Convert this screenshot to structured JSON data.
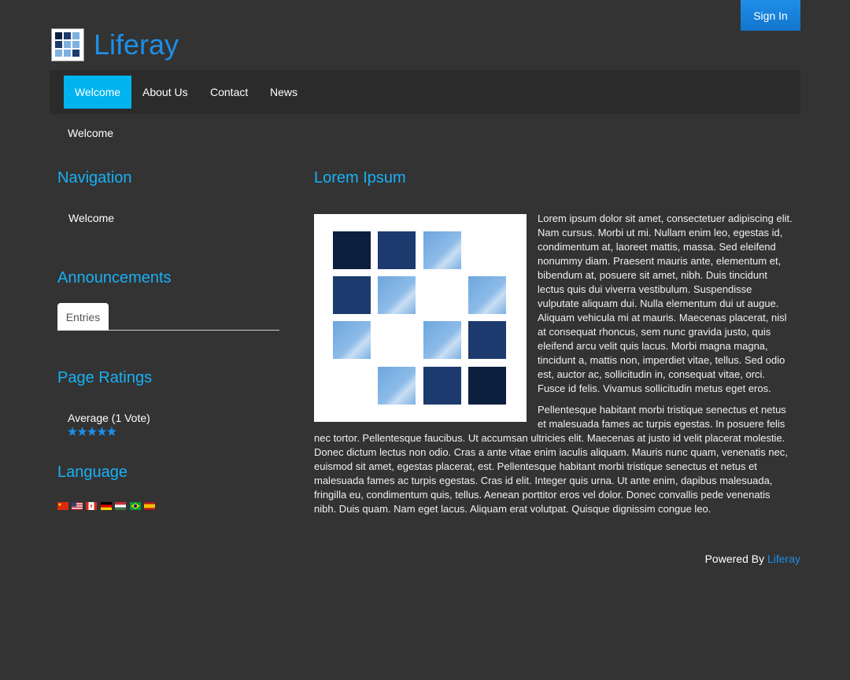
{
  "header": {
    "sign_in_label": "Sign In",
    "site_title": "Liferay",
    "brand_color": "#1e8fe6"
  },
  "nav": {
    "items": [
      {
        "label": "Welcome",
        "active": true
      },
      {
        "label": "About Us",
        "active": false
      },
      {
        "label": "Contact",
        "active": false
      },
      {
        "label": "News",
        "active": false
      }
    ],
    "active_color": "#00b4ef"
  },
  "breadcrumb": "Welcome",
  "navigation_portlet": {
    "title": "Navigation",
    "items": [
      "Welcome"
    ]
  },
  "announcements_portlet": {
    "title": "Announcements",
    "tab_label": "Entries"
  },
  "page_ratings_portlet": {
    "title": "Page Ratings",
    "summary": "Average (1 Vote)",
    "stars_filled": 5,
    "stars_total": 5
  },
  "language_portlet": {
    "title": "Language",
    "flags": [
      "chinese-flag-icon",
      "us-flag-icon",
      "canada-flag-icon",
      "german-flag-icon",
      "hungarian-flag-icon",
      "brazilian-flag-icon",
      "spanish-flag-icon"
    ]
  },
  "content": {
    "title": "Lorem Ipsum",
    "paragraph_1": "Lorem ipsum dolor sit amet, consectetuer adipiscing elit. Nam cursus. Morbi ut mi. Nullam enim leo, egestas id, condimentum at, laoreet mattis, massa. Sed eleifend nonummy diam. Praesent mauris ante, elementum et, bibendum at, posuere sit amet, nibh. Duis tincidunt lectus quis dui viverra vestibulum. Suspendisse vulputate aliquam dui. Nulla elementum dui ut augue. Aliquam vehicula mi at mauris. Maecenas placerat, nisl at consequat rhoncus, sem nunc gravida justo, quis eleifend arcu velit quis lacus. Morbi magna magna, tincidunt a, mattis non, imperdiet vitae, tellus. Sed odio est, auctor ac, sollicitudin in, consequat vitae, orci. Fusce id felis. Vivamus sollicitudin metus eget eros.",
    "paragraph_2": "Pellentesque habitant morbi tristique senectus et netus et malesuada fames ac turpis egestas. In posuere felis nec tortor. Pellentesque faucibus. Ut accumsan ultricies elit. Maecenas at justo id velit placerat molestie. Donec dictum lectus non odio. Cras a ante vitae enim iaculis aliquam. Mauris nunc quam, venenatis nec, euismod sit amet, egestas placerat, est. Pellentesque habitant morbi tristique senectus et netus et malesuada fames ac turpis egestas. Cras id elit. Integer quis urna. Ut ante enim, dapibus malesuada, fringilla eu, condimentum quis, tellus. Aenean porttitor eros vel dolor. Donec convallis pede venenatis nibh. Duis quam. Nam eget lacus. Aliquam erat volutpat. Quisque dignissim congue leo."
  },
  "footer": {
    "powered_by": "Powered By",
    "link_label": "Liferay"
  }
}
